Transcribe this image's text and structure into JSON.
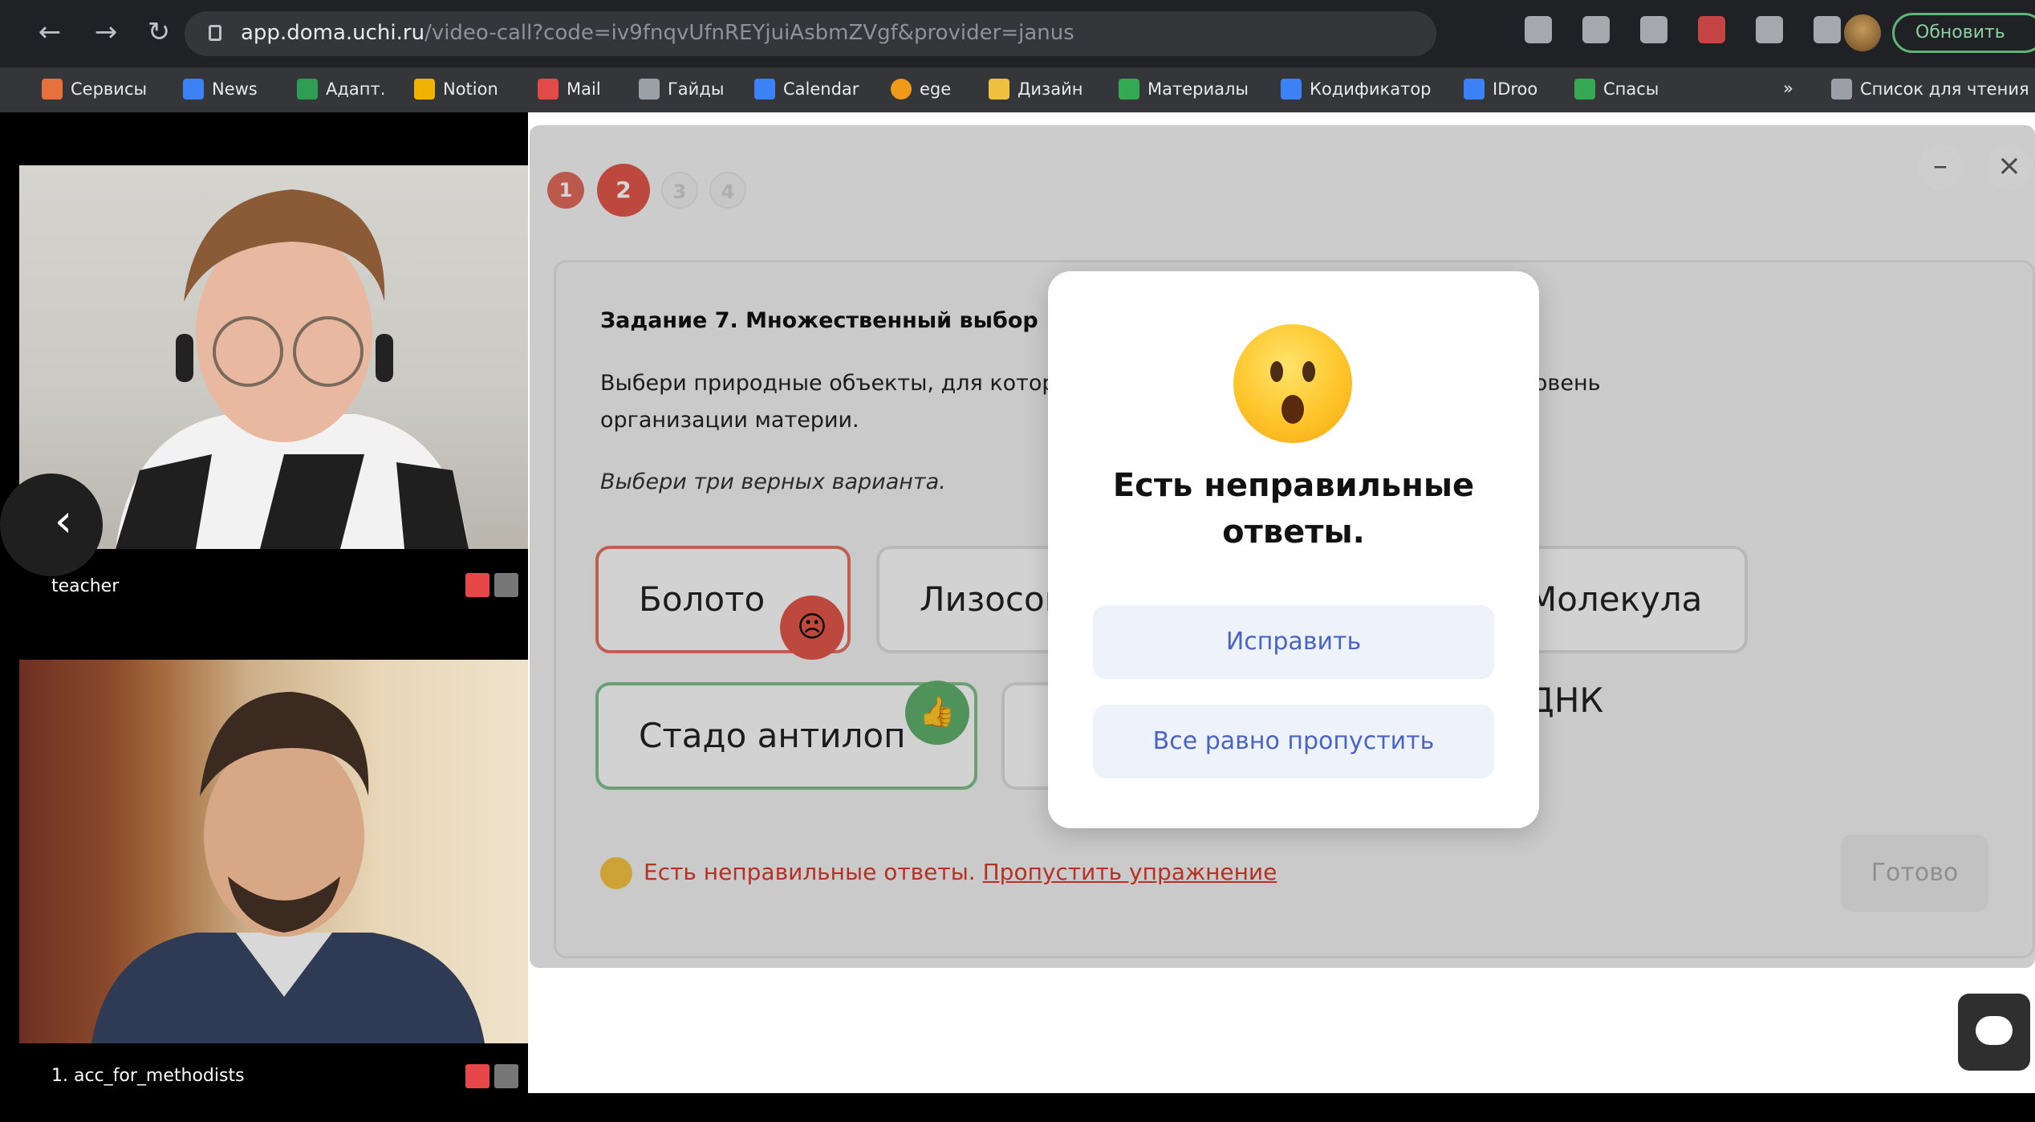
{
  "browser": {
    "url_host": "app.doma.uchi.ru",
    "url_rest": "/video-call?code=iv9fnqvUfnREYjuiAsbmZVgf&provider=janus",
    "update_button": "Обновить",
    "bookmarks": [
      {
        "label": "Сервисы",
        "color": "#e7713d"
      },
      {
        "label": "News",
        "color": "#3c82f6"
      },
      {
        "label": "Адапт.",
        "color": "#2f9e55"
      },
      {
        "label": "Notion",
        "color": "#f0b400"
      },
      {
        "label": "Mail",
        "color": "#e34a4a"
      },
      {
        "label": "Гайды",
        "color": "#9aa0a6"
      },
      {
        "label": "Calendar",
        "color": "#3c82f6"
      },
      {
        "label": "ege",
        "color": "#f09a1a"
      },
      {
        "label": "Дизайн",
        "color": "#f0c040"
      },
      {
        "label": "Материалы",
        "color": "#34a853"
      },
      {
        "label": "Кодификатор",
        "color": "#3c82f6"
      },
      {
        "label": "IDroo",
        "color": "#3c82f6"
      },
      {
        "label": "Спасы",
        "color": "#34a853"
      }
    ],
    "reading_list": "Список для чтения"
  },
  "video": {
    "teacher_label": "teacher",
    "student_label": "1. acc_for_methodists"
  },
  "lesson": {
    "steps": [
      "1",
      "2",
      "3",
      "4"
    ],
    "task_title": "Задание 7. Множественный выбор",
    "task_text": "Выбери природные объекты, для которых характерен популяционно-видовой уровень организации материи.",
    "task_hint": "Выбери три верных варианта.",
    "options": [
      {
        "label": "Болото",
        "state": "wrong"
      },
      {
        "label": "Лизосома",
        "state": "neutral"
      },
      {
        "label": "Молекула ДНК",
        "state": "neutral"
      },
      {
        "label": "Стадо антилоп",
        "state": "right"
      }
    ],
    "feedback_text": "Есть неправильные ответы.",
    "feedback_link": "Пропустить упражнение",
    "done_button": "Готово"
  },
  "modal": {
    "title": "Есть неправильные ответы.",
    "fix_button": "Исправить",
    "skip_button": "Все равно пропустить"
  },
  "colors": {
    "step_done": "#e06a5c",
    "step_current": "#e2584a",
    "step_pending": "#eeeeee",
    "wrong": "#e2584a",
    "right": "#5fb06d",
    "modal_button_text": "#4a64c6"
  }
}
